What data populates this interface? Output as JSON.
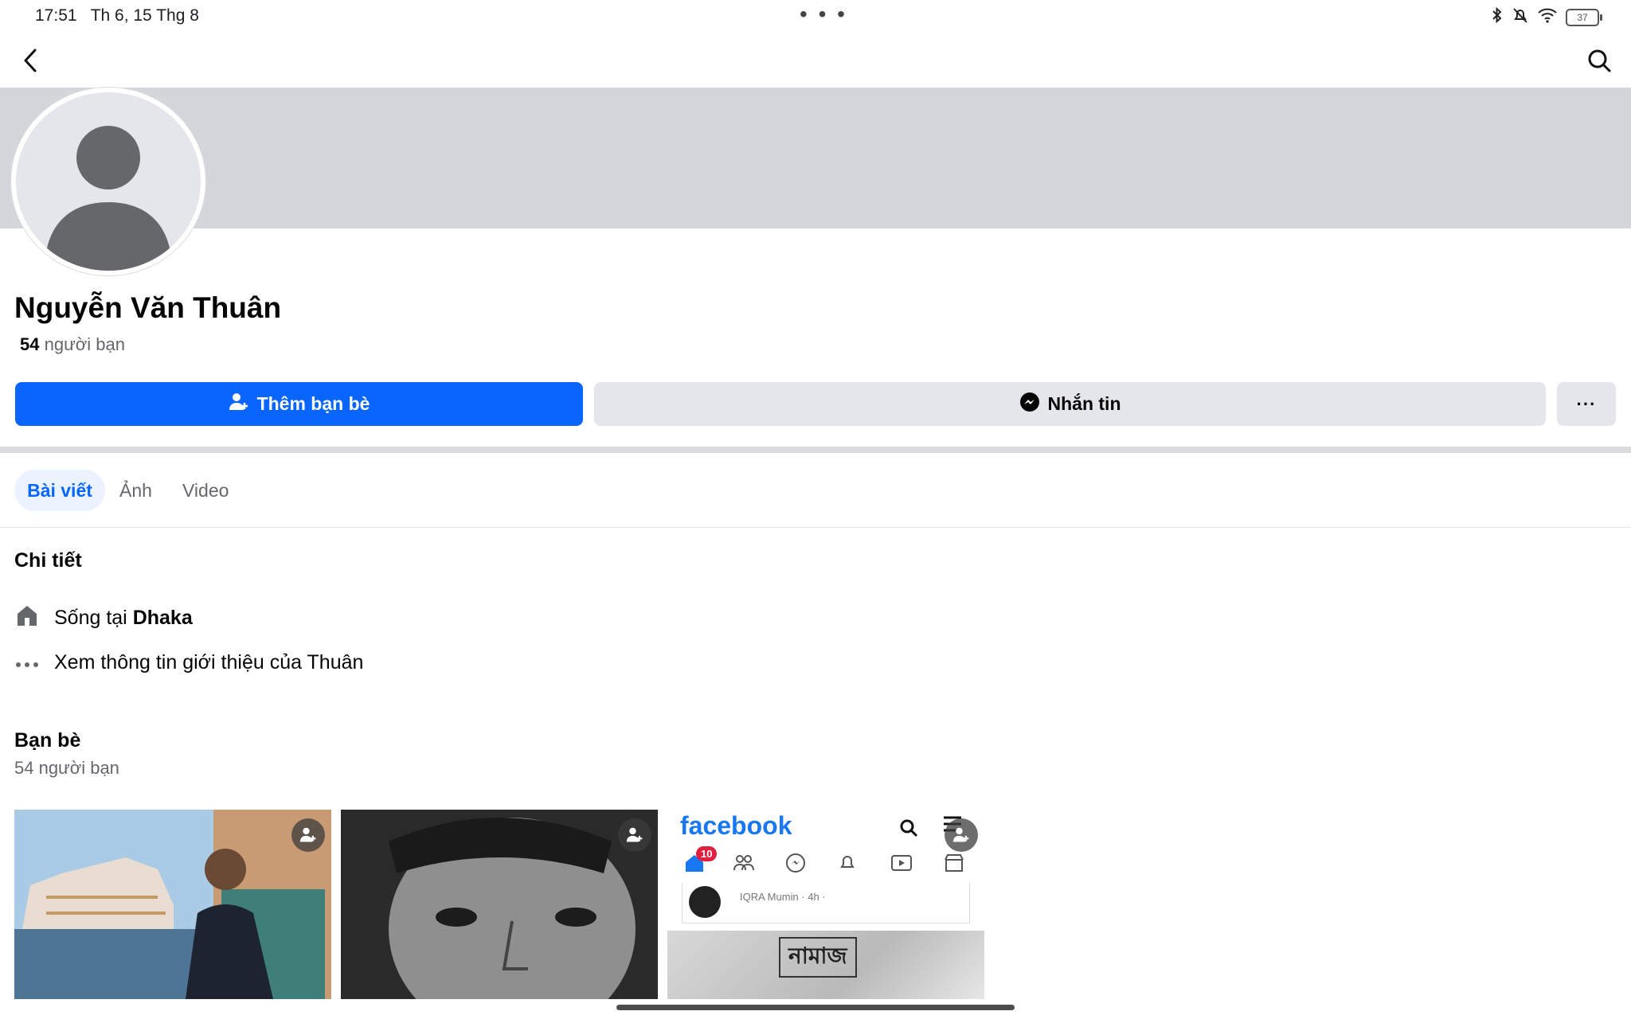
{
  "status_bar": {
    "time": "17:51",
    "date": "Th 6, 15 Thg 8",
    "dots": "• • •",
    "battery": "37"
  },
  "nav": {
    "back_icon": "chevron-left-icon",
    "search_icon": "search-icon"
  },
  "profile": {
    "name": "Nguyễn Văn Thuân",
    "friend_count": "54",
    "friend_count_suffix": " người bạn"
  },
  "actions": {
    "add_friend": "Thêm bạn bè",
    "message": "Nhắn tin",
    "more": "···"
  },
  "tabs": [
    {
      "label": "Bài viết",
      "active": true
    },
    {
      "label": "Ảnh",
      "active": false
    },
    {
      "label": "Video",
      "active": false
    }
  ],
  "details": {
    "heading": "Chi tiết",
    "lives_prefix": "Sống tại ",
    "lives_city": "Dhaka",
    "about_link": "Xem thông tin giới thiệu của Thuân"
  },
  "friends": {
    "heading": "Bạn bè",
    "subtitle": "54 người bạn",
    "tiles": [
      {
        "name": "friend-photo-1"
      },
      {
        "name": "friend-photo-2"
      },
      {
        "name": "friend-photo-3",
        "app_logo": "facebook",
        "notification_count": "10",
        "post_author": "IQRA Mumin · 4h ·",
        "banner_text": "নামাজ"
      }
    ]
  },
  "colors": {
    "primary": "#0866ff",
    "secondary_button": "#e4e6eb",
    "cover": "#d3d6db",
    "muted_text": "#65676b"
  }
}
